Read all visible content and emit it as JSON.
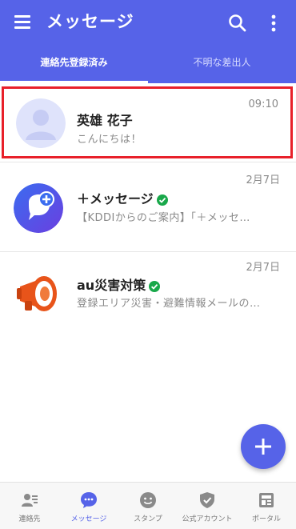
{
  "appbar": {
    "title": "メッセージ",
    "icons": {
      "menu": "menu-icon",
      "search": "search-icon",
      "more": "more-vert-icon"
    },
    "color": "#5663e8"
  },
  "tabs": [
    {
      "label": "連絡先登録済み",
      "active": true
    },
    {
      "label": "不明な差出人",
      "active": false
    }
  ],
  "conversations": [
    {
      "name": "英雄 花子",
      "preview": "こんにちは！",
      "time": "09:10",
      "verified": false,
      "highlighted": true,
      "avatar": "default-person-avatar"
    },
    {
      "name": "＋メッセージ",
      "preview": "【KDDIからのご案内】「＋メッセ…",
      "time": "2月7日",
      "verified": true,
      "highlighted": false,
      "avatar": "plus-message-logo"
    },
    {
      "name": "au災害対策",
      "preview": "登録エリア災害・避難情報メールの…",
      "time": "2月7日",
      "verified": true,
      "highlighted": false,
      "avatar": "au-megaphone-logo"
    }
  ],
  "fab": {
    "icon": "plus-icon"
  },
  "bottom_nav": [
    {
      "label": "連絡先",
      "icon": "contacts-icon",
      "active": false
    },
    {
      "label": "メッセージ",
      "icon": "chat-icon",
      "active": true
    },
    {
      "label": "スタンプ",
      "icon": "smiley-icon",
      "active": false
    },
    {
      "label": "公式アカウント",
      "icon": "shield-icon",
      "active": false
    },
    {
      "label": "ポータル",
      "icon": "portal-icon",
      "active": false
    }
  ],
  "colors": {
    "accent": "#5663e8",
    "highlight_border": "#e8202a",
    "verified": "#19a84a",
    "plus_logo": "#4a55e0",
    "au_orange": "#e8541a"
  }
}
